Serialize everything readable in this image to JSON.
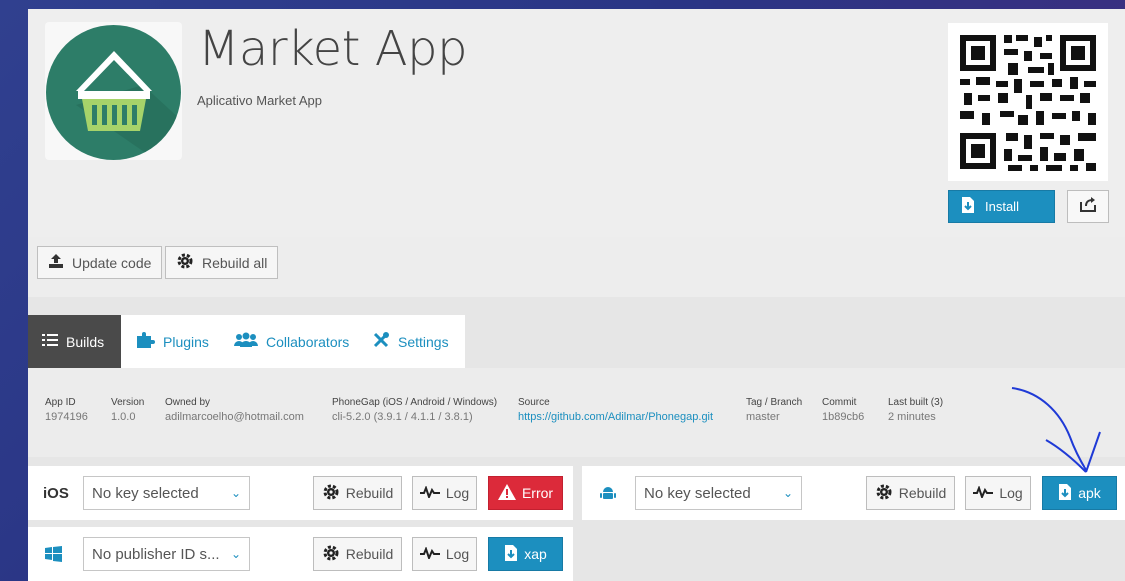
{
  "header": {
    "title": "Market App",
    "description": "Aplicativo Market App",
    "install_label": "Install"
  },
  "toolbar": {
    "update_code_label": "Update code",
    "rebuild_all_label": "Rebuild all"
  },
  "tabs": [
    {
      "label": "Builds",
      "active": true
    },
    {
      "label": "Plugins",
      "active": false
    },
    {
      "label": "Collaborators",
      "active": false
    },
    {
      "label": "Settings",
      "active": false
    }
  ],
  "info": {
    "app_id_label": "App ID",
    "app_id": "1974196",
    "version_label": "Version",
    "version": "1.0.0",
    "owned_by_label": "Owned by",
    "owned_by": "adilmarcoelho@hotmail.com",
    "phonegap_label": "PhoneGap (iOS / Android / Windows)",
    "phonegap": "cli-5.2.0 (3.9.1 / 4.1.1 / 3.8.1)",
    "source_label": "Source",
    "source": "https://github.com/Adilmar/Phonegap.git",
    "tag_label": "Tag / Branch",
    "tag": "master",
    "commit_label": "Commit",
    "commit": "1b89cb6",
    "last_built_label": "Last built (3)",
    "last_built": "2 minutes"
  },
  "ios": {
    "label": "iOS",
    "key": "No key selected",
    "rebuild_label": "Rebuild",
    "log_label": "Log",
    "status_label": "Error"
  },
  "android": {
    "key": "No key selected",
    "rebuild_label": "Rebuild",
    "log_label": "Log",
    "download_label": "apk"
  },
  "windows": {
    "key": "No publisher ID s...",
    "rebuild_label": "Rebuild",
    "log_label": "Log",
    "download_label": "xap"
  },
  "colors": {
    "accent": "#1c8fbf",
    "error": "#dc2a3a",
    "app_icon_bg": "#2d7d68",
    "basket": "#a6d36a"
  }
}
